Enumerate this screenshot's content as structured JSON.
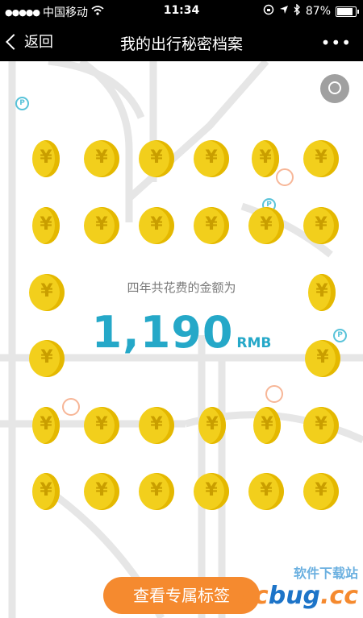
{
  "status_bar": {
    "signal_dots": "●●●●●",
    "carrier": "中国移动",
    "time": "11:34",
    "battery_percent_text": "87%",
    "battery_level": 0.87
  },
  "nav": {
    "back_label": "返回",
    "title": "我的出行秘密档案",
    "more_label": "•••"
  },
  "summary": {
    "label": "四年共花费的金额为",
    "amount": "1,190",
    "unit": "RMB"
  },
  "button": {
    "label": "查看专属标签"
  },
  "watermark": {
    "top": "软件下载站",
    "main_a": "uc",
    "main_b": "bug",
    "main_c": ".cc"
  },
  "colors": {
    "coin": "#f2cf1c",
    "amount": "#25a8c8",
    "button": "#f58a2f"
  }
}
